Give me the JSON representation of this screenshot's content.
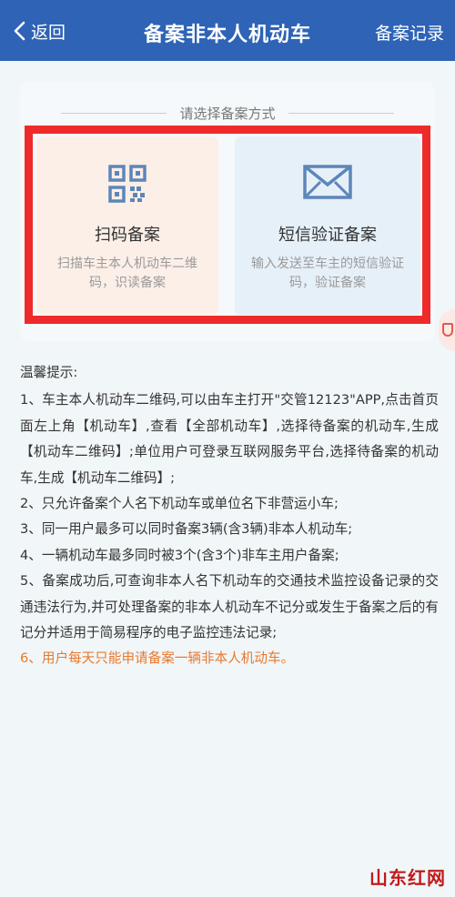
{
  "nav": {
    "back_label": "返回",
    "title": "备案非本人机动车",
    "records_label": "备案记录"
  },
  "section": {
    "title": "请选择备案方式"
  },
  "options": {
    "scan": {
      "title": "扫码备案",
      "desc": "扫描车主本人机动车二维码，识读备案"
    },
    "sms": {
      "title": "短信验证备案",
      "desc": "输入发送至车主的短信验证码，验证备案"
    }
  },
  "tips": {
    "heading": "温馨提示:",
    "items": [
      "1、车主本人机动车二维码,可以由车主打开\"交管12123\"APP,点击首页面左上角【机动车】,查看【全部机动车】,选择待备案的机动车,生成【机动车二维码】;单位用户可登录互联网服务平台,选择待备案的机动车,生成【机动车二维码】;",
      "2、只允许备案个人名下机动车或单位名下非营运小车;",
      "3、同一用户最多可以同时备案3辆(含3辆)非本人机动车;",
      "4、一辆机动车最多同时被3个(含3个)非车主用户备案;",
      "5、备案成功后,可查询非本人名下机动车的交通技术监控设备记录的交通违法行为,并可处理备案的非本人机动车不记分或发生于备案之后的有记分并适用于简易程序的电子监控违法记录;",
      "6、用户每天只能申请备案一辆非本人机动车。"
    ]
  },
  "watermark": "山东红网",
  "colors": {
    "nav_bg": "#2e63b6",
    "highlight": "#ef2a2a",
    "warning_text": "#e8792d",
    "icon_blue": "#5d86b8"
  }
}
